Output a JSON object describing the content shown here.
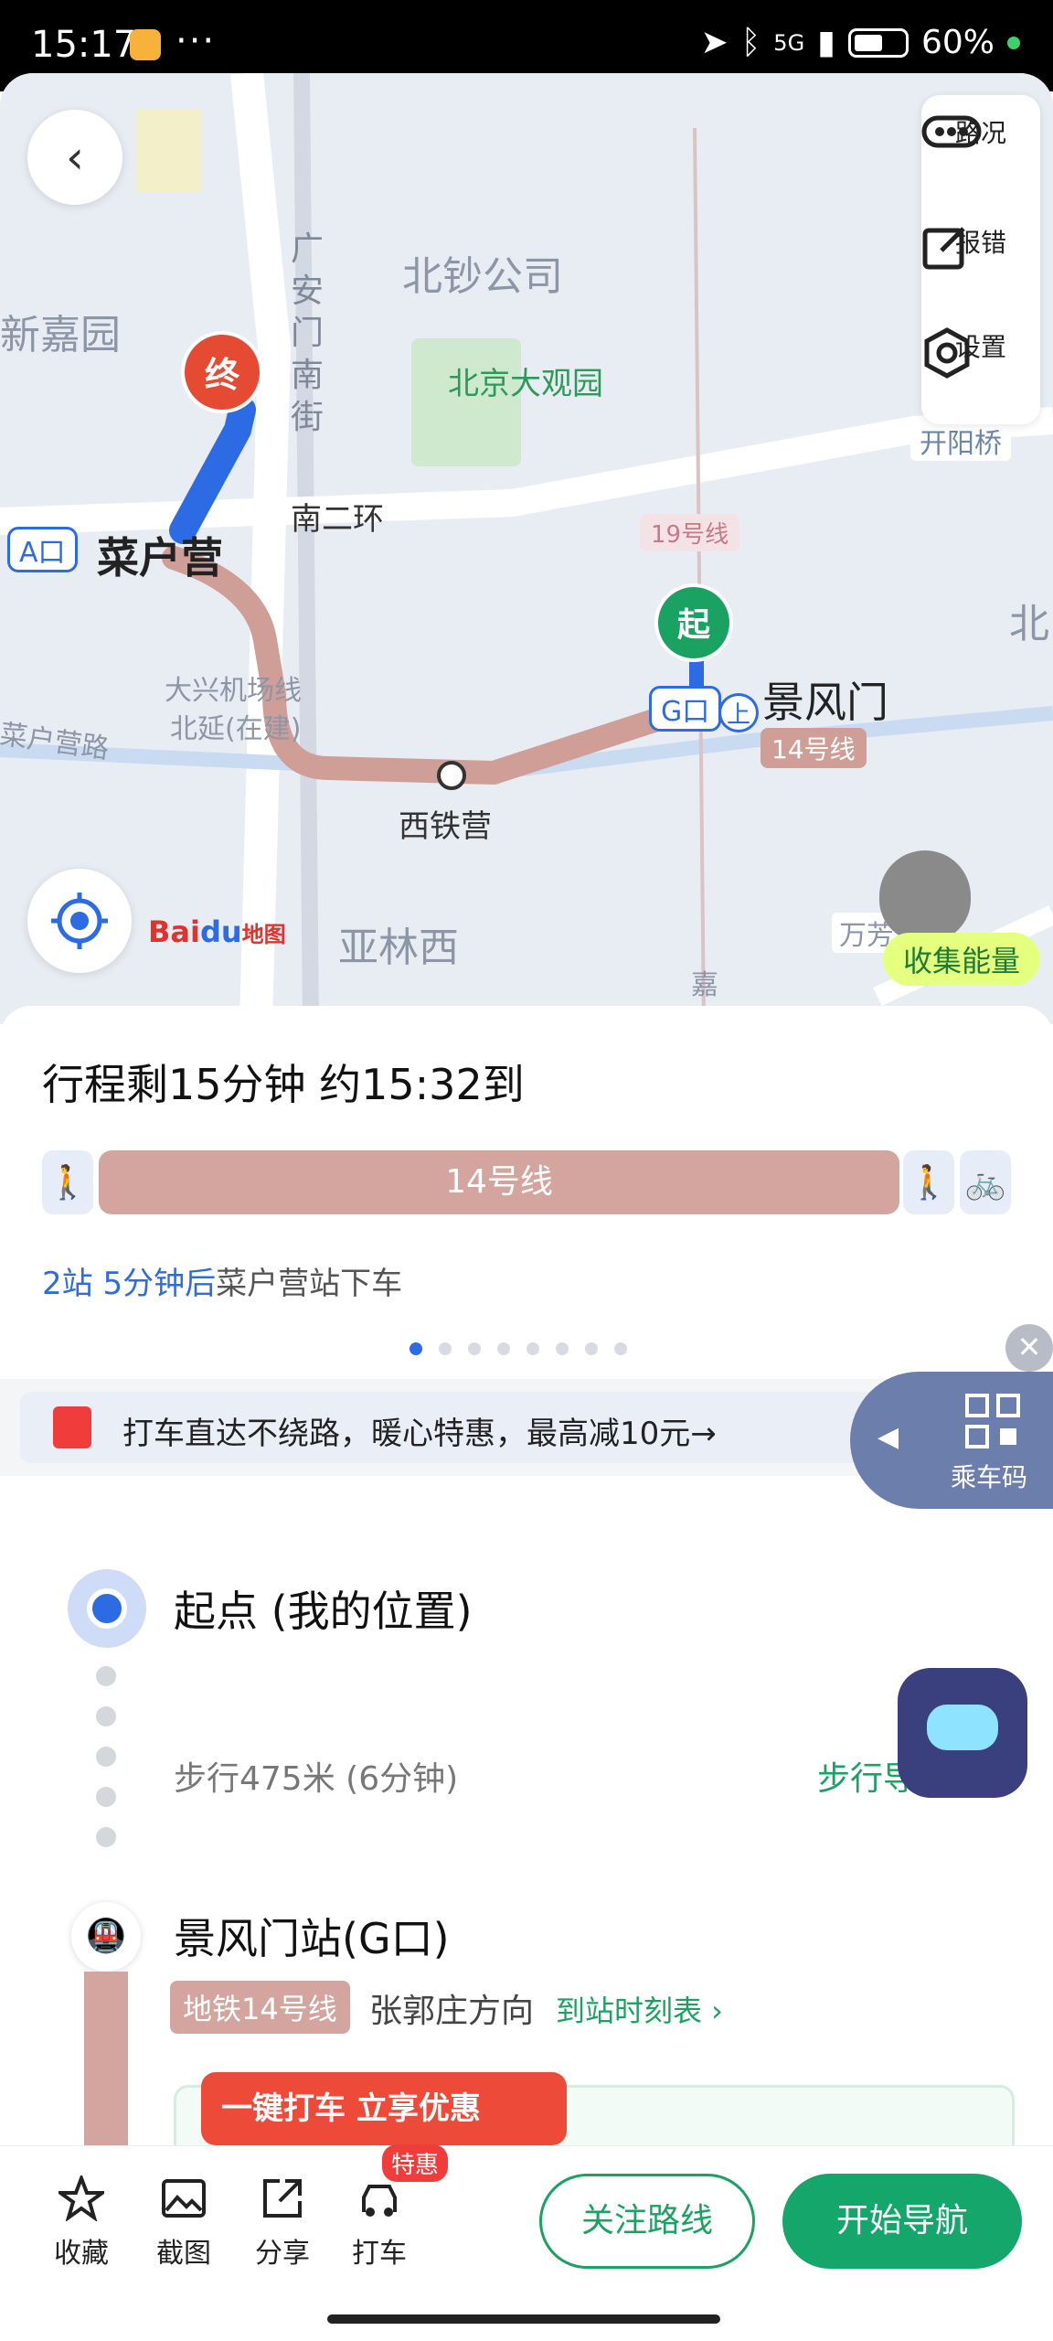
{
  "status_bar": {
    "time": "15:17",
    "more": "···",
    "network": "5G",
    "battery": "60%"
  },
  "map": {
    "labels": {
      "xinjiayuan": "新嘉园",
      "beichaogongsi": "北钞公司",
      "daguanyuan": "北京大观园",
      "nanerhuan": "南二环",
      "caihuying": "菜户营",
      "line19": "19号线",
      "jingfengmen": "景风门",
      "line14": "14号线",
      "airport_line": "大兴机场线",
      "airport_line2": "北延(在建)",
      "caihuying_road": "菜户营路",
      "xitieying": "西铁营",
      "yalinxi": "亚林西",
      "kaiyangqiao": "开阳桥",
      "wanfang": "万芳",
      "jia": "嘉",
      "bei": "北",
      "guanganmen_street": "广安门南街"
    },
    "end_pin": "终",
    "start_pin": "起",
    "exit_a": "A口",
    "exit_g": "G口",
    "board": "上",
    "right_panel": {
      "traffic": "路况",
      "report": "报错",
      "settings": "设置"
    },
    "logo": "Bai",
    "logo_du": "du",
    "logo_map": "地图",
    "energy": "收集能量"
  },
  "sheet": {
    "trip_title": "行程剩15分钟 约15:32到",
    "segment_line": "14号线",
    "stop_info_blue": "2站 5分钟后",
    "stop_info_rest": "菜户营站下车",
    "promo_text": "打车直达不绕路，暖心特惠，最高减10元→",
    "ride_code": "乘车码",
    "start_title": "起点 (我的位置)",
    "walk_text": "步行475米 (6分钟)",
    "walk_button": "步行导",
    "station_title": "景风门站(G口)",
    "line_badge": "地铁14号线",
    "direction": "张郭庄方向",
    "timetable": "到站时刻表 ›",
    "taxi_promo": "一键打车 立享优惠"
  },
  "toolbar": {
    "favorite": "收藏",
    "screenshot": "截图",
    "share": "分享",
    "taxi": "打车",
    "taxi_badge": "特惠",
    "follow_route": "关注路线",
    "start_nav": "开始导航"
  },
  "colors": {
    "accent_blue": "#2d6be4",
    "green": "#14a66a",
    "line14": "#d4a59e",
    "end_red": "#e54b33"
  }
}
